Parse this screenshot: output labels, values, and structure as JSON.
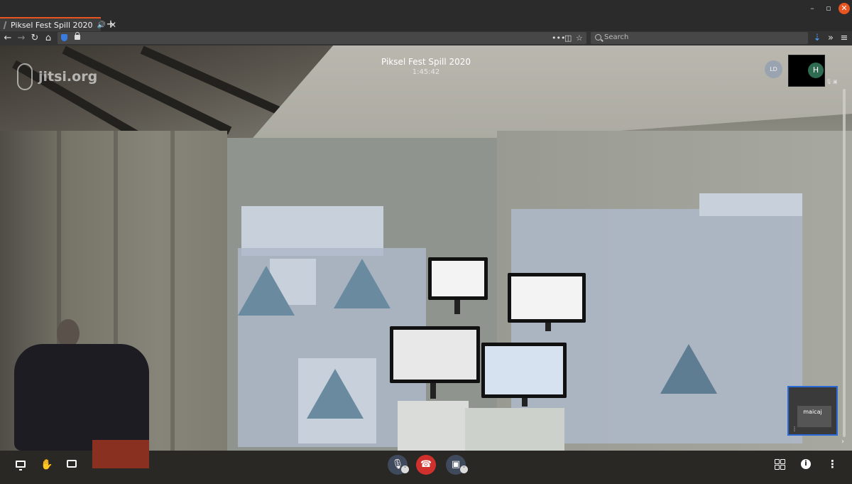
{
  "browser": {
    "tab": {
      "title": "Piksel Fest Spill 2020"
    },
    "search": {
      "placeholder": "Search"
    },
    "window_controls": {
      "minimize": "–",
      "maximize": "▫",
      "close": "✕"
    }
  },
  "meeting": {
    "logo_text": "jitsi.org",
    "title": "Piksel Fest Spill 2020",
    "timer": "1:45:42",
    "participants": [
      {
        "initials": "LD",
        "avatar_color": "#9aa3b0"
      },
      {
        "initials": "H",
        "avatar_color": "#2f6b50",
        "muted": true,
        "video_off": true
      },
      {
        "name": "maicaj",
        "active": true
      }
    ],
    "toolbar": {
      "left": [
        "screen-share-icon",
        "raise-hand-icon",
        "chat-icon"
      ],
      "center": [
        "microphone-muted-icon",
        "hangup-icon",
        "camera-off-icon"
      ],
      "right": [
        "tile-view-icon",
        "info-icon",
        "more-options-icon"
      ]
    }
  },
  "colors": {
    "accent": "#e95420",
    "hangup": "#d0312d",
    "active_border": "#2a6ad8"
  }
}
